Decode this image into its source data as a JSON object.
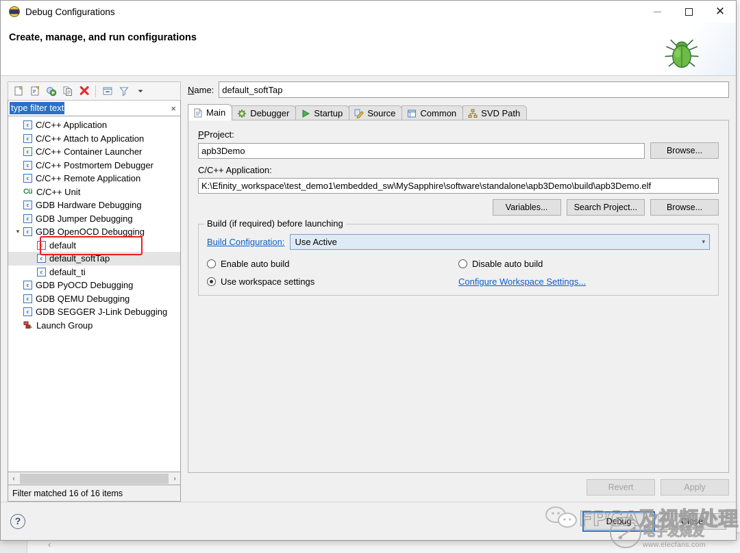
{
  "window": {
    "title": "Debug Configurations",
    "icon": "eclipse-icon",
    "minimize_label": "Minimize",
    "maximize_label": "Maximize",
    "close_label": "Close"
  },
  "banner": {
    "heading": "Create, manage, and run configurations",
    "mascot": "bug-icon"
  },
  "left_panel": {
    "toolbar": [
      {
        "name": "new-launch-configuration",
        "tooltip": "New launch configuration"
      },
      {
        "name": "new-prototype",
        "tooltip": "New prototype"
      },
      {
        "name": "export-launch-configuration",
        "tooltip": "Export"
      },
      {
        "name": "duplicate-configuration",
        "tooltip": "Duplicate"
      },
      {
        "name": "delete-configuration",
        "tooltip": "Delete"
      },
      {
        "name": "collapse-all",
        "tooltip": "Collapse All"
      },
      {
        "name": "filter-configurations",
        "tooltip": "Filter"
      },
      {
        "name": "view-menu",
        "tooltip": "View Menu"
      }
    ],
    "filter": {
      "value": "type filter text",
      "placeholder": "type filter text",
      "clear_label": "×"
    },
    "tree": [
      {
        "label": "C/C++ Application",
        "icon": "c-file-icon",
        "level": 0
      },
      {
        "label": "C/C++ Attach to Application",
        "icon": "c-file-icon",
        "level": 0
      },
      {
        "label": "C/C++ Container Launcher",
        "icon": "c-file-icon",
        "level": 0
      },
      {
        "label": "C/C++ Postmortem Debugger",
        "icon": "c-file-icon",
        "level": 0
      },
      {
        "label": "C/C++ Remote Application",
        "icon": "c-file-icon",
        "level": 0
      },
      {
        "label": "C/C++ Unit",
        "icon": "cunit-icon",
        "level": 0
      },
      {
        "label": "GDB Hardware Debugging",
        "icon": "c-file-icon",
        "level": 0
      },
      {
        "label": "GDB Jumper Debugging",
        "icon": "c-file-icon",
        "level": 0
      },
      {
        "label": "GDB OpenOCD Debugging",
        "icon": "c-file-icon",
        "level": 0,
        "expanded": true
      },
      {
        "label": "default",
        "icon": "c-file-icon",
        "level": 1
      },
      {
        "label": "default_softTap",
        "icon": "c-file-icon",
        "level": 1,
        "selected": true
      },
      {
        "label": "default_ti",
        "icon": "c-file-icon",
        "level": 1
      },
      {
        "label": "GDB PyOCD Debugging",
        "icon": "c-file-icon",
        "level": 0
      },
      {
        "label": "GDB QEMU Debugging",
        "icon": "c-file-icon",
        "level": 0
      },
      {
        "label": "GDB SEGGER J-Link Debugging",
        "icon": "c-file-icon",
        "level": 0
      },
      {
        "label": "Launch Group",
        "icon": "launch-group-icon",
        "level": 0
      }
    ],
    "status": "Filter matched 16 of 16 items",
    "scroll_left": "‹",
    "scroll_right": "›"
  },
  "name_field": {
    "label": "Name:",
    "value": "default_softTap"
  },
  "tabs": [
    {
      "label": "Main",
      "icon": "document-icon",
      "active": true
    },
    {
      "label": "Debugger",
      "icon": "debugger-gear-icon",
      "active": false
    },
    {
      "label": "Startup",
      "icon": "play-icon",
      "active": false
    },
    {
      "label": "Source",
      "icon": "pencil-icon",
      "active": false
    },
    {
      "label": "Common",
      "icon": "table-icon",
      "active": false
    },
    {
      "label": "SVD Path",
      "icon": "hierarchy-icon",
      "active": false
    }
  ],
  "main_tab": {
    "project_label": "Project:",
    "project_value": "apb3Demo",
    "project_browse": "Browse...",
    "application_label": "C/C++ Application:",
    "application_value": "K:\\Efinity_workspace\\test_demo1\\embedded_sw\\MySapphire\\software\\standalone\\apb3Demo\\build\\apb3Demo.elf",
    "variables_button": "Variables...",
    "search_project_button": "Search Project...",
    "app_browse_button": "Browse...",
    "build_group_title": "Build (if required) before launching",
    "build_config_link": "Build Configuration:",
    "build_config_value": "Use Active",
    "radios": {
      "enable_auto_build": {
        "label": "Enable auto build",
        "selected": false
      },
      "disable_auto_build": {
        "label": "Disable auto build",
        "selected": false
      },
      "use_workspace_settings": {
        "label": "Use workspace settings",
        "selected": true
      }
    },
    "configure_workspace_link": "Configure Workspace Settings..."
  },
  "action_buttons": {
    "revert": "Revert",
    "apply": "Apply",
    "revert_enabled": false,
    "apply_enabled": false
  },
  "footer": {
    "help_label": "?",
    "debug_button": "Debug",
    "close_button": "Close"
  },
  "watermark": {
    "wechat_text": "FPGA及视频处理",
    "brand_cn": "电子发烧友",
    "brand_url": "www.elecfans.com"
  },
  "colors": {
    "accent_blue": "#0b5ec7",
    "selection_blue": "#2a6fc9",
    "annotation_red": "#ee1c1c",
    "combo_focus_bg": "#dfeaf7"
  }
}
